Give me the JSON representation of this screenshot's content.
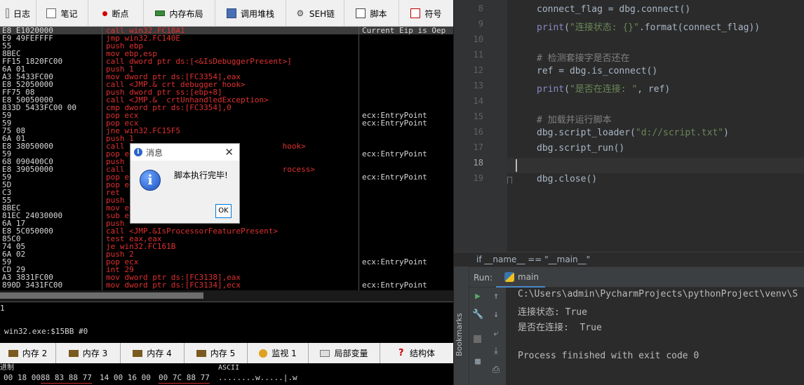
{
  "debugger": {
    "tabs": [
      {
        "label": "日志",
        "icon": "log-icon"
      },
      {
        "label": "笔记",
        "icon": "notes-icon"
      },
      {
        "label": "断点",
        "icon": "breakpoint-icon"
      },
      {
        "label": "内存布局",
        "icon": "memory-map-icon"
      },
      {
        "label": "调用堆栈",
        "icon": "call-stack-icon"
      },
      {
        "label": "SEH链",
        "icon": "seh-chain-icon"
      },
      {
        "label": "脚本",
        "icon": "script-icon"
      },
      {
        "label": "符号",
        "icon": "symbols-icon"
      }
    ],
    "disasm": [
      {
        "bytes": "E8 E1020000",
        "asm": "call win32.FC18A1",
        "comment": "Current Eip is Oep"
      },
      {
        "bytes": "E9 49FEFFFF",
        "asm": "jmp win32.FC140E",
        "comment": ""
      },
      {
        "bytes": "55",
        "asm": "push ebp",
        "comment": ""
      },
      {
        "bytes": "8BEC",
        "asm": "mov ebp,esp",
        "comment": ""
      },
      {
        "bytes": "FF15 1820FC00",
        "asm": "call dword ptr ds:[<&IsDebuggerPresent>]",
        "comment": ""
      },
      {
        "bytes": "6A 01",
        "asm": "push 1",
        "comment": ""
      },
      {
        "bytes": "A3 5433FC00",
        "asm": "mov dword ptr ds:[FC3354],eax",
        "comment": ""
      },
      {
        "bytes": "E8 52050000",
        "asm": "call <JMP.&_crt_debugger_hook>",
        "comment": ""
      },
      {
        "bytes": "FF75 08",
        "asm": "push dword ptr ss:[ebp+8]",
        "comment": ""
      },
      {
        "bytes": "E8 50050000",
        "asm": "call <JMP.&__crtUnhandledException>",
        "comment": ""
      },
      {
        "bytes": "833D 5433FC00 00",
        "asm": "cmp dword ptr ds:[FC3354],0",
        "comment": ""
      },
      {
        "bytes": "59",
        "asm": "pop ecx",
        "comment": "ecx:EntryPoint"
      },
      {
        "bytes": "59",
        "asm": "pop ecx",
        "comment": "ecx:EntryPoint"
      },
      {
        "bytes": "75 08",
        "asm": "jne win32.FC15F5",
        "comment": ""
      },
      {
        "bytes": "6A 01",
        "asm": "push 1",
        "comment": ""
      },
      {
        "bytes": "E8 38050000",
        "asm": "call                                  hook>",
        "comment": ""
      },
      {
        "bytes": "59",
        "asm": "pop e",
        "comment": "ecx:EntryPoint"
      },
      {
        "bytes": "68 090400C0",
        "asm": "push",
        "comment": ""
      },
      {
        "bytes": "E8 39050000",
        "asm": "call                                  rocess>",
        "comment": ""
      },
      {
        "bytes": "59",
        "asm": "pop e",
        "comment": "ecx:EntryPoint"
      },
      {
        "bytes": "5D",
        "asm": "pop e",
        "comment": ""
      },
      {
        "bytes": "C3",
        "asm": "ret",
        "comment": ""
      },
      {
        "bytes": "55",
        "asm": "push",
        "comment": ""
      },
      {
        "bytes": "8BEC",
        "asm": "mov e",
        "comment": ""
      },
      {
        "bytes": "81EC 24030000",
        "asm": "sub e",
        "comment": ""
      },
      {
        "bytes": "6A 17",
        "asm": "push",
        "comment": ""
      },
      {
        "bytes": "E8 5C050000",
        "asm": "call <JMP.&IsProcessorFeaturePresent>",
        "comment": ""
      },
      {
        "bytes": "85C0",
        "asm": "test eax,eax",
        "comment": ""
      },
      {
        "bytes": "74 05",
        "asm": "je win32.FC161B",
        "comment": ""
      },
      {
        "bytes": "6A 02",
        "asm": "push 2",
        "comment": ""
      },
      {
        "bytes": "59",
        "asm": "pop ecx",
        "comment": "ecx:EntryPoint"
      },
      {
        "bytes": "CD 29",
        "asm": "int 29",
        "comment": ""
      },
      {
        "bytes": "A3 3831FC00",
        "asm": "mov dword ptr ds:[FC3138],eax",
        "comment": ""
      },
      {
        "bytes": "890D 3431FC00",
        "asm": "mov dword ptr ds:[FC3134],ecx",
        "comment": "ecx:EntryPoint"
      }
    ],
    "info_line1": "1",
    "info_line2": "win32.exe:$15BB #0",
    "dump_tabs": [
      {
        "label": "内存 2",
        "icon": "memory-icon"
      },
      {
        "label": "内存 3",
        "icon": "memory-icon"
      },
      {
        "label": "内存 4",
        "icon": "memory-icon"
      },
      {
        "label": "内存 5",
        "icon": "memory-icon"
      },
      {
        "label": "监视 1",
        "icon": "watch-icon"
      },
      {
        "label": "局部变量",
        "icon": "locals-icon"
      },
      {
        "label": "结构体",
        "icon": "struct-icon"
      }
    ],
    "dump_header_hex": "进制",
    "dump_header_ascii": "ASCII",
    "dump_row": {
      "g1": "00 18 00",
      "g2": "88 83 88 77",
      "g3": "14 00 16 00",
      "g4": "00 7C 88 77",
      "ascii": "........w.....|.w"
    }
  },
  "dialog": {
    "title": "消息",
    "message": "脚本执行完毕!",
    "ok": "OK"
  },
  "ide": {
    "lines": [
      {
        "num": "8",
        "code": "connect_flag = dbg.connect()"
      },
      {
        "num": "9",
        "pre": "print(",
        "str": "\"连接状态: {}\"",
        "post": ".format(connect_flag))"
      },
      {
        "num": "10",
        "code": ""
      },
      {
        "num": "11",
        "comment": "# 检测套接字是否还在"
      },
      {
        "num": "12",
        "code": "ref = dbg.is_connect()"
      },
      {
        "num": "13",
        "pre": "print(",
        "str": "\"是否在连接: \"",
        "post": ", ref)"
      },
      {
        "num": "14",
        "code": ""
      },
      {
        "num": "15",
        "comment": "# 加载并运行脚本"
      },
      {
        "num": "16",
        "pre": "dbg.script_loader(",
        "str": "\"d://script.txt\"",
        "post": ")"
      },
      {
        "num": "17",
        "code": "dbg.script_run()"
      },
      {
        "num": "18",
        "code": ""
      },
      {
        "num": "19",
        "pre": "dbg.close(",
        "str": "",
        "post": ")"
      }
    ],
    "breadcrumb": "if __name__ == \"__main__\"",
    "run_label": "Run:",
    "run_tab": "main",
    "bookmarks": "Bookmarks",
    "console": [
      "C:\\Users\\admin\\PycharmProjects\\pythonProject\\venv\\S",
      "连接状态: True",
      "是否在连接:  True",
      "",
      "Process finished with exit code 0"
    ]
  }
}
